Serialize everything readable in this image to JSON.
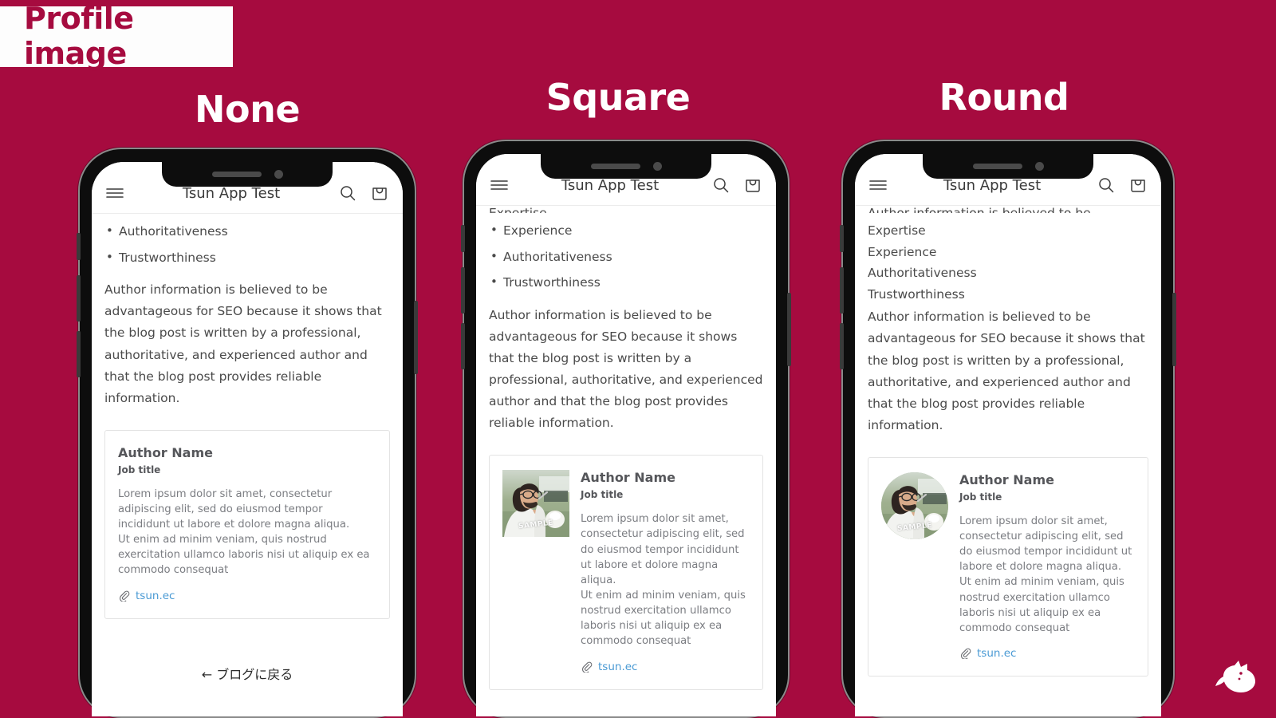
{
  "page": {
    "badge_title": "Profile image",
    "background_color": "#A60B3F",
    "badge_bg": "#FDFDFD",
    "badge_text_color": "#A60B3F",
    "link_color": "#4A9AD4"
  },
  "headings": {
    "none": "None",
    "square": "Square",
    "round": "Round"
  },
  "app_header": {
    "title": "Tsun App Test",
    "menu_icon": "hamburger-menu-icon",
    "search_icon": "search-icon",
    "cart_icon": "shopping-bag-icon"
  },
  "article": {
    "eeat_full": [
      "Expertise",
      "Experience",
      "Authoritativeness",
      "Trustworthiness"
    ],
    "eeat_phone1": [
      "Authoritativeness",
      "Trustworthiness"
    ],
    "eeat_phone2": [
      "Experience",
      "Authoritativeness",
      "Trustworthiness"
    ],
    "eeat_phone3": [
      "Expertise",
      "Experience",
      "Authoritativeness",
      "Trustworthiness"
    ],
    "paragraph": "Author information is believed to be advantageous for SEO because it shows that the blog post is written by a professional, authoritative, and experienced author and that the blog post provides reliable information.",
    "back_link": "← ブログに戻る"
  },
  "author_card": {
    "name": "Author Name",
    "job_title": "Job title",
    "bio": "Lorem ipsum dolor sit amet, consectetur adipiscing elit, sed do eiusmod tempor incididunt ut labore et dolore magna aliqua.\nUt enim ad minim veniam, quis nostrud exercitation ullamco laboris nisi ut aliquip ex ea commodo consequat",
    "link_text": "tsun.ec",
    "link_icon": "paperclip-icon",
    "image_watermark": "SAMPLE",
    "image_alt": "profile-photo-man-with-glasses"
  },
  "corner_logo": {
    "name": "dog-head-logo"
  }
}
